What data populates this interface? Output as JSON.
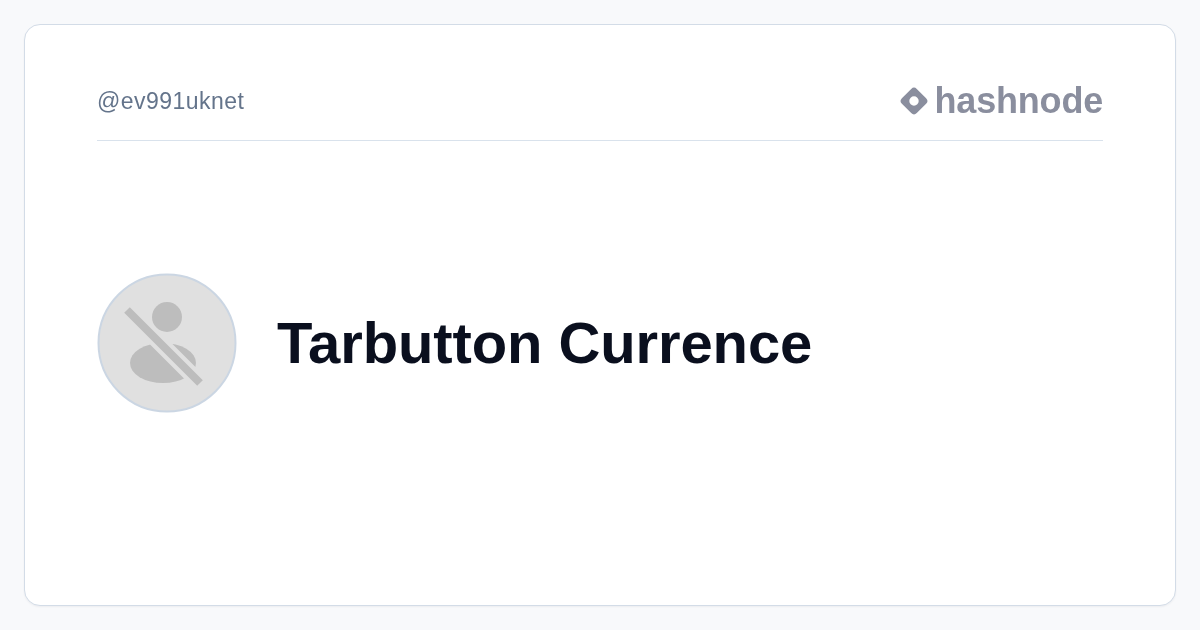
{
  "card": {
    "handle": "@ev991uknet",
    "logo": {
      "text": "hashnode"
    },
    "author": {
      "name": "Tarbutton Currence"
    }
  }
}
